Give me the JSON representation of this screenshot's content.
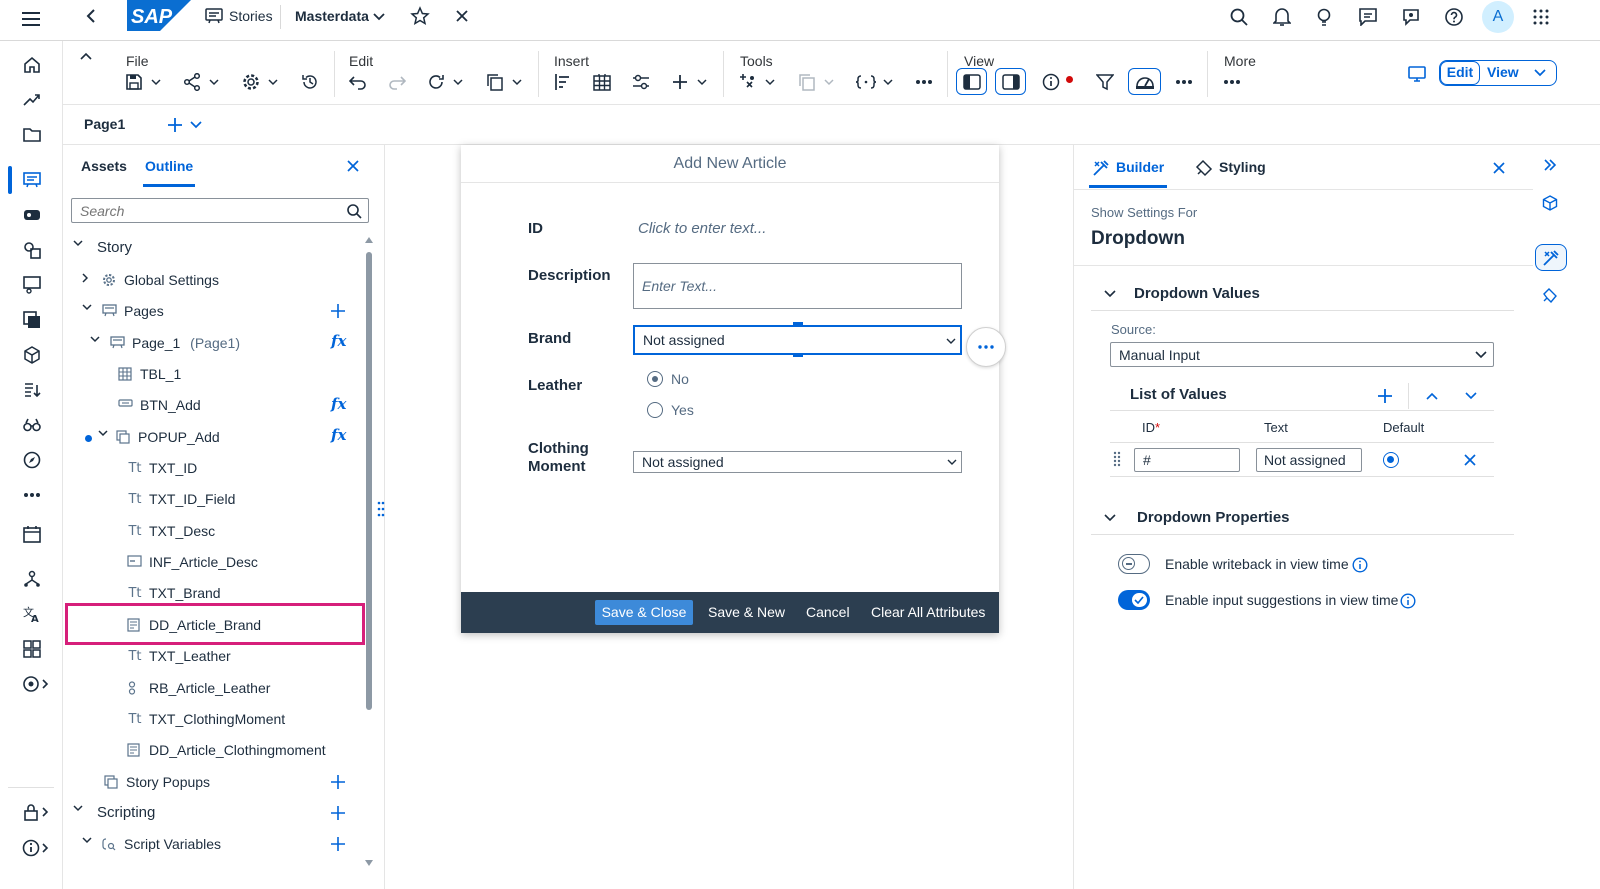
{
  "shell": {
    "stories_label": "Stories",
    "masterdata_label": "Masterdata",
    "avatar_initial": "A",
    "brand_color": "#0a6ed1"
  },
  "toolbar": {
    "file": "File",
    "edit": "Edit",
    "insert": "Insert",
    "tools": "Tools",
    "view": "View",
    "more": "More",
    "edit_btn": "Edit",
    "view_btn": "View"
  },
  "pagebar": {
    "page_tab": "Page1"
  },
  "outline": {
    "tab_assets": "Assets",
    "tab_outline": "Outline",
    "search_placeholder": "Search",
    "items": {
      "story": "Story",
      "global_settings": "Global Settings",
      "pages": "Pages",
      "page_1": "Page_1",
      "page_1_alias": "(Page1)",
      "tbl_1": "TBL_1",
      "btn_add": "BTN_Add",
      "popup_add": "POPUP_Add",
      "txt_id": "TXT_ID",
      "txt_id_field": "TXT_ID_Field",
      "txt_desc": "TXT_Desc",
      "inf_article_desc": "INF_Article_Desc",
      "txt_brand": "TXT_Brand",
      "dd_article_brand": "DD_Article_Brand",
      "txt_leather": "TXT_Leather",
      "rb_article_leather": "RB_Article_Leather",
      "txt_clothingmoment": "TXT_ClothingMoment",
      "dd_article_clothingmoment": "DD_Article_Clothingmoment",
      "story_popups": "Story Popups",
      "scripting": "Scripting",
      "script_variables": "Script Variables"
    },
    "highlight_color": "#d61f7a"
  },
  "dialog": {
    "title": "Add New Article",
    "id_label": "ID",
    "id_placeholder": "Click to enter text...",
    "desc_label": "Description",
    "desc_placeholder": "Enter Text...",
    "brand_label": "Brand",
    "brand_value": "Not assigned",
    "leather_label": "Leather",
    "radio_no": "No",
    "radio_yes": "Yes",
    "clothing_label_1": "Clothing",
    "clothing_label_2": "Moment",
    "clothing_value": "Not assigned",
    "save_close": "Save & Close",
    "save_new": "Save & New",
    "cancel": "Cancel",
    "clear_all": "Clear All Attributes"
  },
  "builder": {
    "tab_builder": "Builder",
    "tab_styling": "Styling",
    "show_settings_for": "Show Settings For",
    "component": "Dropdown",
    "dropdown_values": "Dropdown Values",
    "source_label": "Source:",
    "source_value": "Manual Input",
    "list_of_values": "List of Values",
    "col_id": "ID",
    "col_id_required": "*",
    "col_text": "Text",
    "col_default": "Default",
    "row_id_value": "#",
    "row_text_value": "Not assigned",
    "dropdown_properties": "Dropdown Properties",
    "enable_writeback": "Enable writeback in view time",
    "enable_suggestions": "Enable input suggestions in view time",
    "writeback_enabled": false,
    "suggestions_enabled": true
  }
}
